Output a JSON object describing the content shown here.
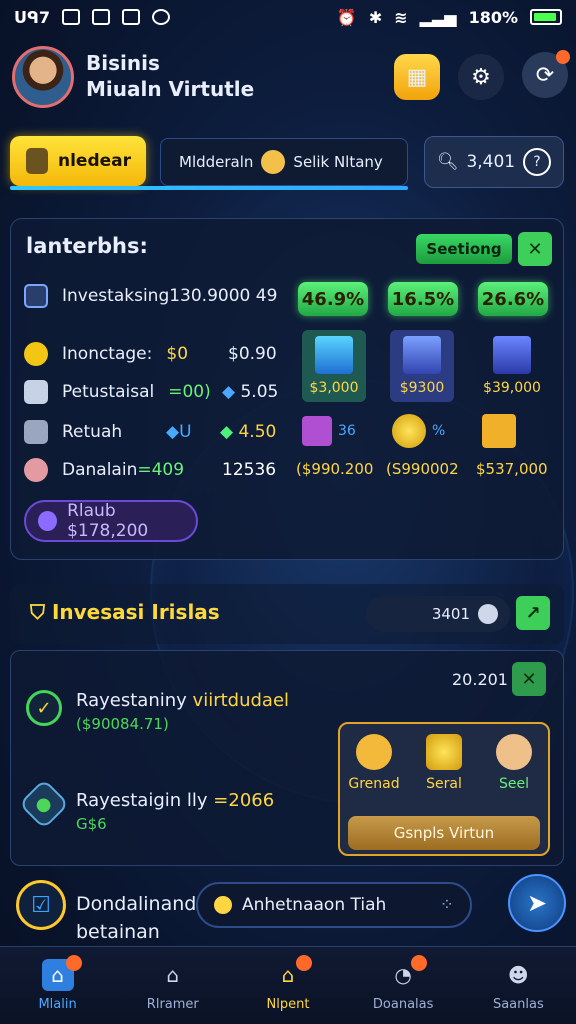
{
  "status_bar": {
    "left_text": "ᑌᑫ7",
    "battery": "180%"
  },
  "profile": {
    "name_line1": "Bisinis",
    "name_line2": "Miualn Virtutle"
  },
  "tabs": {
    "active_label": "nledear",
    "second_label": "Mldderaln",
    "second_label_b": "Selik Nltany",
    "search_value": "3,401"
  },
  "panel": {
    "title": "lanterbhs:",
    "settings_label": "Seetiong",
    "rows": [
      {
        "label": "Investaksing130.9000 49",
        "value_a": "",
        "value_b": ""
      },
      {
        "label": "Inonctage:",
        "value_a": "$0",
        "value_b": "$0.90"
      },
      {
        "label": "Petustaisal",
        "value_a": "=00)",
        "value_b": "5.05"
      },
      {
        "label": "Retuah",
        "value_a": "U",
        "value_b": "4.50"
      },
      {
        "label": "Danalain",
        "value_a": "=409",
        "value_b": "12536"
      }
    ],
    "percents": [
      "46.9%",
      "16.5%",
      "26.6%"
    ],
    "cards": [
      {
        "price": "$3,000"
      },
      {
        "price": "$9300"
      },
      {
        "price": "$39,000"
      }
    ],
    "small_cards": [
      "36",
      "%",
      ""
    ],
    "totals": [
      "($990.200",
      "(S990002",
      "$537,000"
    ],
    "pill": "Rlaub $178,200"
  },
  "invest": {
    "title": "Invesasi Irislas",
    "search_value": "3401",
    "top_value": "20.201",
    "items": [
      {
        "title": "Rayestaniny",
        "highlight": "viirtdudael",
        "sub": "($90084.71)"
      },
      {
        "title": "Rayestaigin lly",
        "highlight": "=2066",
        "sub": "G$6"
      }
    ],
    "shop": {
      "items": [
        "Grenad",
        "Seral",
        "Seel"
      ],
      "button": "Gsnpls Virtun"
    }
  },
  "bottom": {
    "line1": "Dondalinand",
    "line2": "betainan",
    "input": "Anhetnaaon Tiah"
  },
  "nav": {
    "items": [
      "Mlalin",
      "Rlramer",
      "Nlpent",
      "Doanalas",
      "Saanlas"
    ]
  },
  "colors": {
    "accent": "#ffd642",
    "green": "#3ecf5b",
    "panel": "#0e1a34",
    "purple": "#6b4ad8"
  }
}
